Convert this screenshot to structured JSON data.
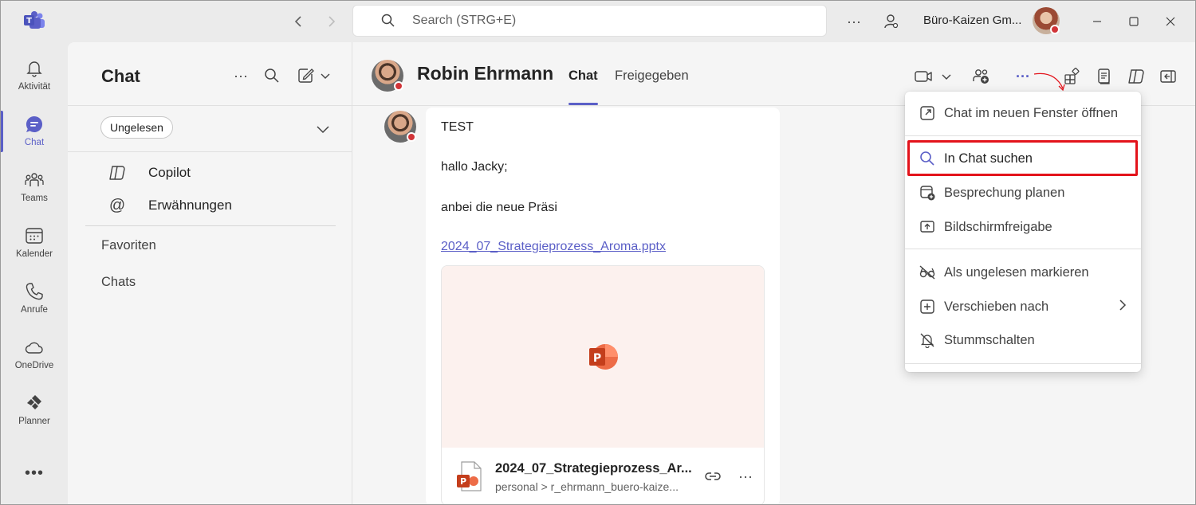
{
  "titlebar": {
    "search_placeholder": "Search (STRG+E)",
    "org_name": "Büro-Kaizen Gm..."
  },
  "rail": {
    "items": [
      {
        "label": "Aktivität",
        "icon": "bell-icon"
      },
      {
        "label": "Chat",
        "icon": "chat-icon",
        "active": true
      },
      {
        "label": "Teams",
        "icon": "teams-icon"
      },
      {
        "label": "Kalender",
        "icon": "calendar-icon"
      },
      {
        "label": "Anrufe",
        "icon": "phone-icon"
      },
      {
        "label": "OneDrive",
        "icon": "cloud-icon"
      },
      {
        "label": "Planner",
        "icon": "planner-icon"
      }
    ]
  },
  "listpane": {
    "title": "Chat",
    "filter_chip": "Ungelesen",
    "rows": [
      "Copilot",
      "Erwähnungen"
    ],
    "sections": [
      "Favoriten",
      "Chats"
    ]
  },
  "header": {
    "person_name": "Robin Ehrmann",
    "tabs": [
      "Chat",
      "Freigegeben"
    ]
  },
  "message": {
    "lines": [
      "TEST",
      "hallo Jacky;",
      "anbei die neue Präsi"
    ],
    "link": "2024_07_Strategieprozess_Aroma.pptx",
    "file": {
      "name": "2024_07_Strategieprozess_Ar...",
      "path": "personal > r_ehrmann_buero-kaize..."
    }
  },
  "menu": {
    "items": [
      {
        "label": "Chat im neuen Fenster öffnen",
        "icon": "popout-icon"
      },
      {
        "label": "In Chat suchen",
        "icon": "search-icon",
        "highlighted": true
      },
      {
        "label": "Besprechung planen",
        "icon": "calendar-add-icon"
      },
      {
        "label": "Bildschirmfreigabe",
        "icon": "share-screen-icon"
      },
      {
        "label": "Als ungelesen markieren",
        "icon": "eye-off-icon"
      },
      {
        "label": "Verschieben nach",
        "icon": "move-icon",
        "submenu": true
      },
      {
        "label": "Stummschalten",
        "icon": "bell-off-icon"
      }
    ]
  },
  "colors": {
    "accent": "#5b5fc7",
    "highlight_box": "#e3131b",
    "presence_busy": "#d13438",
    "powerpoint": "#c43e1c"
  }
}
